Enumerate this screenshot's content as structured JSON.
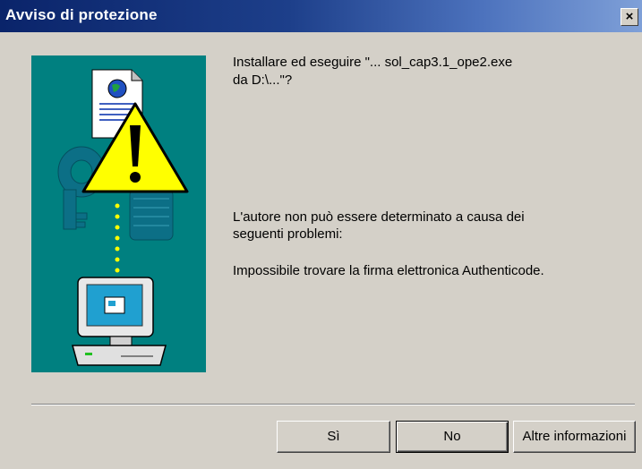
{
  "window": {
    "title": "Avviso di protezione",
    "close_glyph": "×"
  },
  "message": {
    "line1": "Installare ed eseguire \"...  sol_cap3.1_ope2.exe",
    "line2": "da D:\\...\"?",
    "problem_line1": "L'autore non può essere determinato a causa dei",
    "problem_line2": "seguenti problemi:",
    "signature_error": "Impossibile trovare la firma elettronica Authenticode."
  },
  "buttons": {
    "yes": "Sì",
    "no": "No",
    "more_info": "Altre informazioni"
  },
  "illustration": {
    "icon": "security-warning-icon",
    "background": "#008080"
  },
  "colors": {
    "titlebar_start": "#0a246a",
    "titlebar_end": "#7fa0d8",
    "dialog_bg": "#d4d0c8"
  }
}
